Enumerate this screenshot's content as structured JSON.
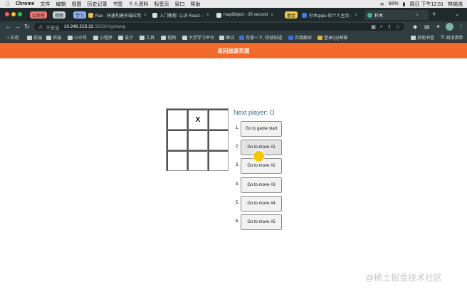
{
  "menubar": {
    "app": "Chrome",
    "menus": [
      "文件",
      "编辑",
      "视图",
      "历史记录",
      "书签",
      "个人资料",
      "标签页",
      "窗口",
      "帮助"
    ],
    "battery": "68%",
    "clock": "周日 下午12:51",
    "user": "林锡浩"
  },
  "tabs": {
    "groups": [
      {
        "label": "公众号",
        "color": "#e8776f"
      },
      {
        "label": "视频",
        "color": "#c9d3d6"
      },
      {
        "label": "学习",
        "color": "#8fb4f3"
      },
      {
        "label": "基金",
        "color": "#f2c94c"
      }
    ],
    "items": [
      {
        "title": "Rax - 快速构建多端应用"
      },
      {
        "title": "入门教程: 认识 React –"
      },
      {
        "title": "mapObject - 30 second"
      },
      {
        "title": "柠木qiqiu 的个人主页 -"
      },
      {
        "title": "柠木"
      }
    ]
  },
  "address": {
    "insecure_label": "不安全",
    "url_host": "10.248.215.32",
    "url_rest": ":3333/#/gobang"
  },
  "bookmarks": {
    "items": [
      "应用",
      "前端",
      "后端",
      "公众号",
      "小程序",
      "设计",
      "工具",
      "视频",
      "大学学习平台",
      "面试",
      "百度一下, 你就知道",
      "百度翻译",
      "登录QQ邮箱"
    ],
    "other": "其他书签",
    "reading_list": "阅读清单"
  },
  "page": {
    "header_title": "返回旅游页面",
    "board": [
      "",
      "X",
      "",
      "",
      "",
      "",
      "",
      "",
      ""
    ],
    "status": "Next player: O",
    "moves": [
      {
        "num": "1.",
        "label": "Go to game start"
      },
      {
        "num": "2.",
        "label": "Go to move #1"
      },
      {
        "num": "3.",
        "label": "Go to move #2"
      },
      {
        "num": "4.",
        "label": "Go to move #3"
      },
      {
        "num": "5.",
        "label": "Go to move #4"
      },
      {
        "num": "6.",
        "label": "Go to move #5"
      }
    ]
  },
  "watermark": "@稀土掘金技术社区",
  "colors": {
    "accent_orange": "#f26a2a",
    "status_text": "#3e6f8c",
    "cursor_highlight": "#f7c800"
  }
}
